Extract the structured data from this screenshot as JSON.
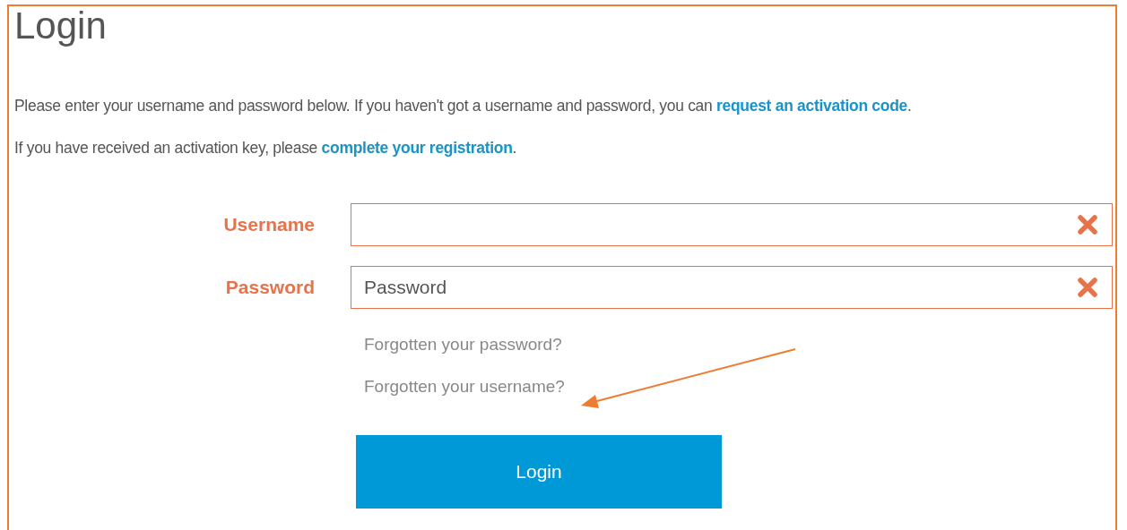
{
  "title": "Login",
  "intro": [
    {
      "before": "Please enter your username and password below. If you haven't got a username and password, you can ",
      "link": "request an activation code",
      "after": "."
    },
    {
      "before": "If you have received an activation key, please ",
      "link": "complete your registration",
      "after": "."
    }
  ],
  "fields": [
    {
      "label": "Username",
      "error": true
    },
    {
      "label": "Password",
      "placeholder": "Password",
      "error": true
    }
  ],
  "links": [
    "Forgotten your password?",
    "Forgotten your username?"
  ],
  "button": "Login",
  "annotation": {
    "kind": "arrow"
  }
}
